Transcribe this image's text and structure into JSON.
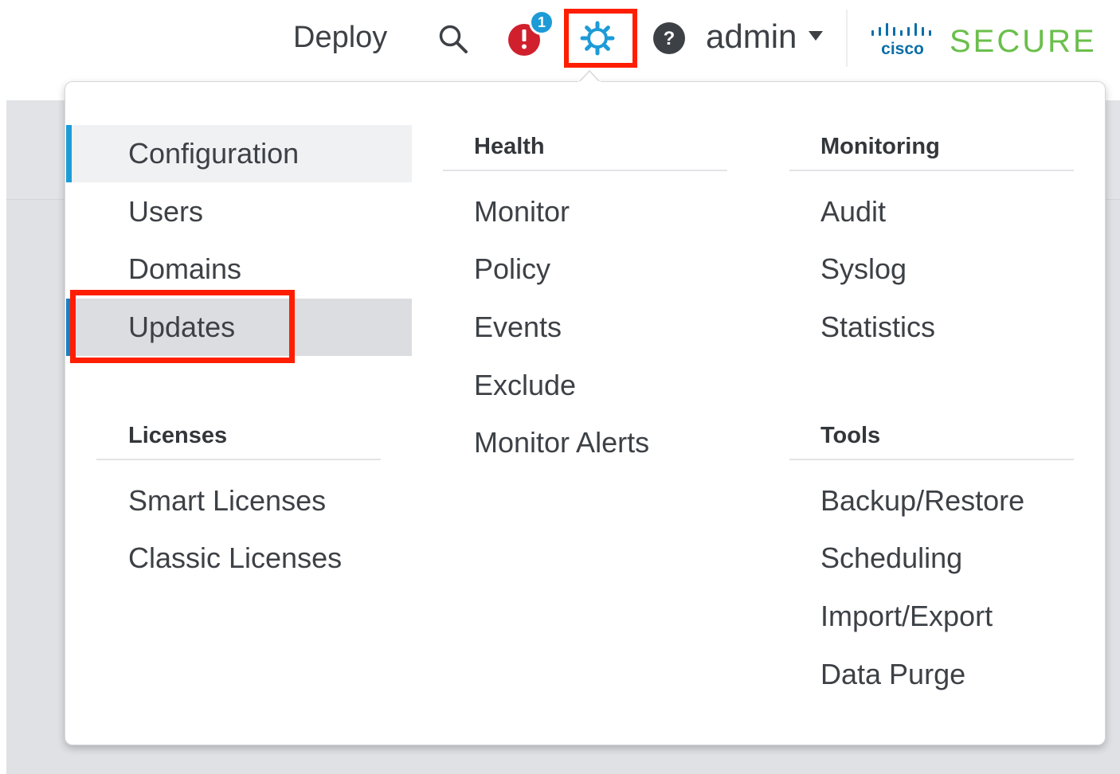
{
  "header": {
    "deploy_label": "Deploy",
    "alert_count": "1",
    "user_label": "admin",
    "brand": {
      "cisco_text": "cisco",
      "product_text": "SECURE",
      "product_color": "#6abf4b"
    },
    "icons": {
      "search": "search-icon",
      "alert": "alert-icon",
      "settings": "gear-icon",
      "help": "help-icon",
      "caret": "caret-down-icon"
    }
  },
  "menu": {
    "col1": {
      "items": [
        "Configuration",
        "Users",
        "Domains",
        "Updates"
      ],
      "licenses_heading": "Licenses",
      "licenses_items": [
        "Smart Licenses",
        "Classic Licenses"
      ]
    },
    "health": {
      "heading": "Health",
      "items": [
        "Monitor",
        "Policy",
        "Events",
        "Exclude",
        "Monitor Alerts"
      ]
    },
    "monitoring": {
      "heading": "Monitoring",
      "items": [
        "Audit",
        "Syslog",
        "Statistics"
      ]
    },
    "tools": {
      "heading": "Tools",
      "items": [
        "Backup/Restore",
        "Scheduling",
        "Import/Export",
        "Data Purge"
      ]
    }
  },
  "colors": {
    "accent": "#1d9bd7",
    "highlight_box": "#ff1e00",
    "alert_red": "#d0202e"
  }
}
